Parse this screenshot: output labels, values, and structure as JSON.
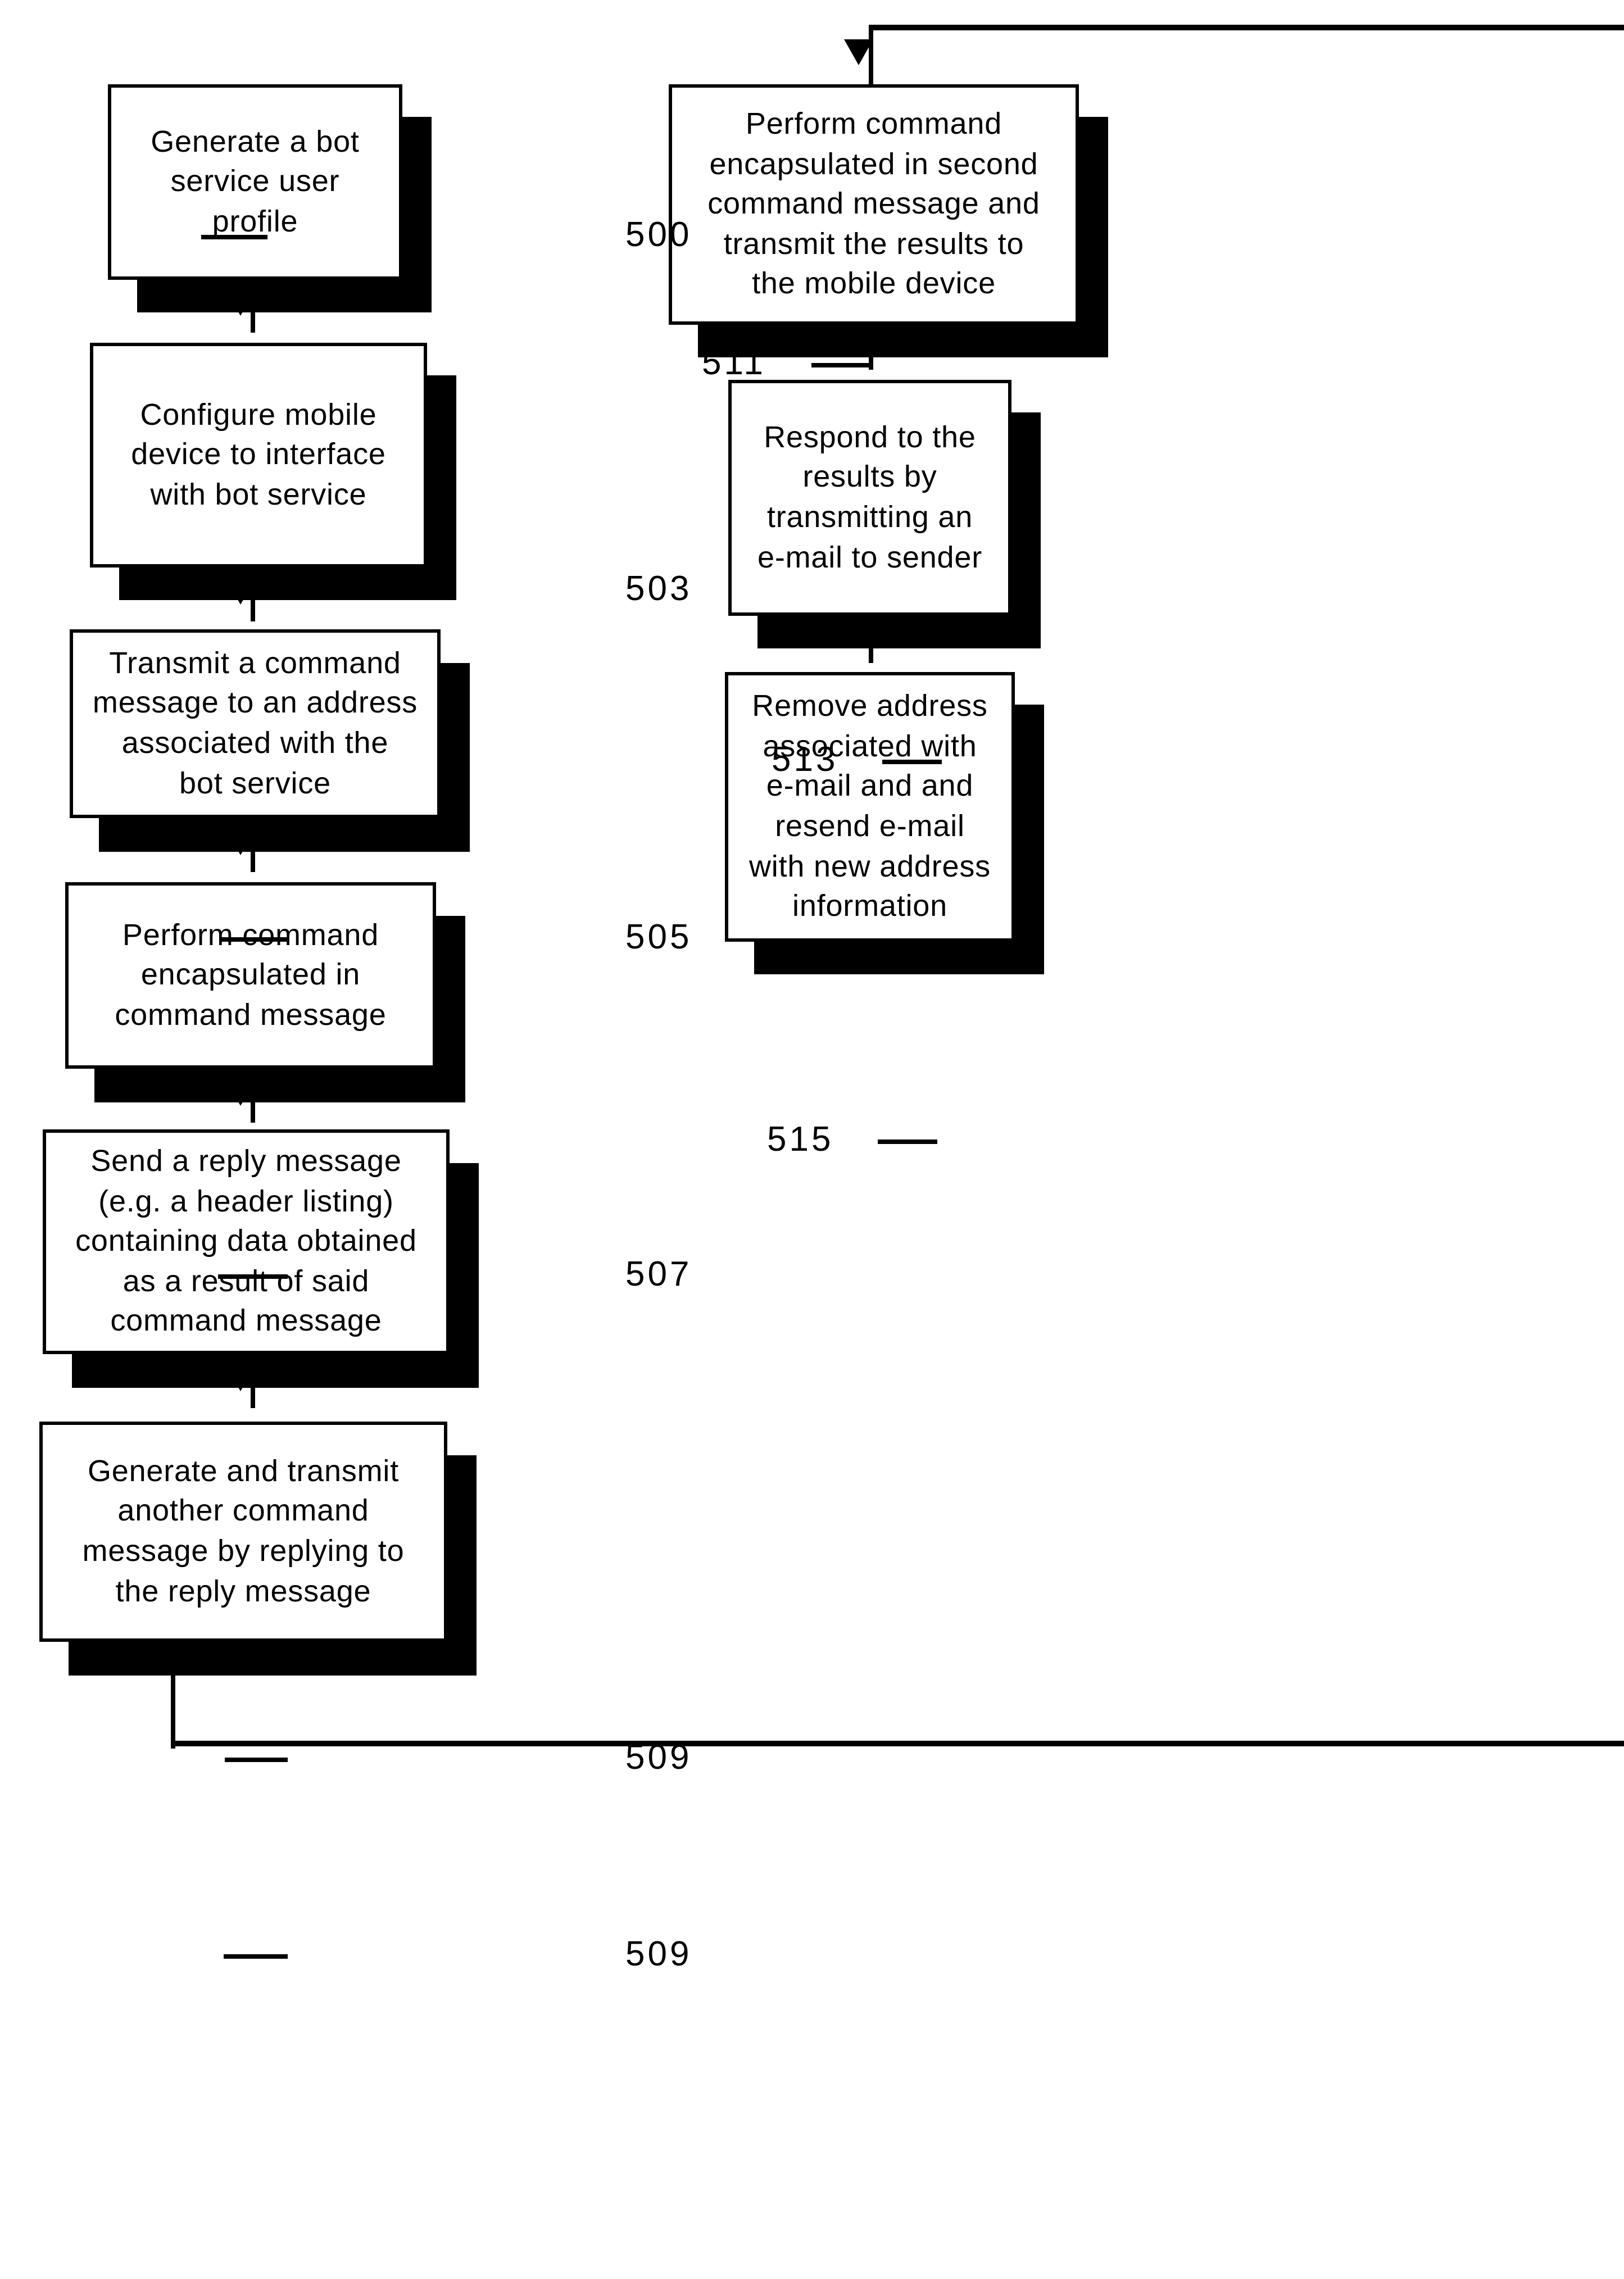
{
  "figure": {
    "type": "patent-flowchart",
    "orientation": "two-column",
    "background_color": "#ffffff",
    "line_color": "#000000"
  },
  "nodes": [
    {
      "id": "n500",
      "ref": "500",
      "column": "left",
      "order": 1,
      "text": "Generate a bot\nservice  user\nprofile"
    },
    {
      "id": "n503",
      "ref": "503",
      "column": "left",
      "order": 2,
      "text": "Configure  mobile\ndevice  to  interface\nwith  bot  service"
    },
    {
      "id": "n505",
      "ref": "505",
      "column": "left",
      "order": 3,
      "text": "Transmit a command\nmessage to an address\nassociated  with  the\nbot  service"
    },
    {
      "id": "n507",
      "ref": "507",
      "column": "left",
      "order": 4,
      "text": "Perform  command\nencapsulated  in\ncommand  message"
    },
    {
      "id": "n509a",
      "ref": "509",
      "column": "left",
      "order": 5,
      "text": "Send a reply message\n(e.g. a header listing)\ncontaining  data  obtained\nas  a  result  of said\ncommand  message"
    },
    {
      "id": "n509b",
      "ref": "509",
      "column": "left",
      "order": 6,
      "text": "Generate  and  transmit\nanother  command\nmessage by replying to\nthe reply message"
    },
    {
      "id": "n511",
      "ref": "511",
      "column": "right",
      "order": 7,
      "text": "Perform  command\nencapsulated in second\ncommand message and\ntransmit  the  results  to\nthe  mobile  device"
    },
    {
      "id": "n513",
      "ref": "513",
      "column": "right",
      "order": 8,
      "text": "Respond to the\nresults  by\ntransmitting  an\ne-mail  to  sender"
    },
    {
      "id": "n515",
      "ref": "515",
      "column": "right",
      "order": 9,
      "text": "Remove address\nassociated  with\ne-mail and and\nresend  e-mail\nwith  new  address\ninformation"
    }
  ],
  "edges": [
    {
      "from": "n500",
      "to": "n503",
      "style": "arrow-down"
    },
    {
      "from": "n503",
      "to": "n505",
      "style": "arrow-down"
    },
    {
      "from": "n505",
      "to": "n507",
      "style": "arrow-down"
    },
    {
      "from": "n507",
      "to": "n509a",
      "style": "arrow-down"
    },
    {
      "from": "n509a",
      "to": "n509b",
      "style": "arrow-down"
    },
    {
      "from": "n509b",
      "to": "n511",
      "style": "loop-around-right"
    },
    {
      "from": "n511",
      "to": "n513",
      "style": "arrow-down"
    },
    {
      "from": "n513",
      "to": "n515",
      "style": "arrow-down"
    }
  ]
}
